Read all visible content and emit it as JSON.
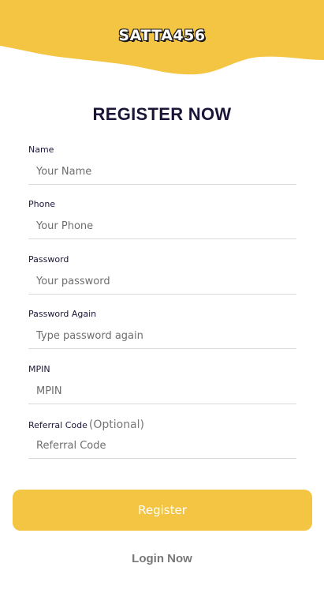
{
  "brand": {
    "logo_text": "SATTA456",
    "accent_color": "#f4c443"
  },
  "page": {
    "title": "REGISTER NOW"
  },
  "form": {
    "fields": [
      {
        "label": "Name",
        "placeholder": "Your Name",
        "value": ""
      },
      {
        "label": "Phone",
        "placeholder": "Your Phone",
        "value": ""
      },
      {
        "label": "Password",
        "placeholder": "Your password",
        "value": ""
      },
      {
        "label": "Password Again",
        "placeholder": "Type password again",
        "value": ""
      },
      {
        "label": "MPIN",
        "placeholder": "MPIN",
        "value": ""
      },
      {
        "label": "Referral Code",
        "label_suffix": "(Optional)",
        "placeholder": "Referral Code",
        "value": ""
      }
    ]
  },
  "actions": {
    "register_label": "Register",
    "login_label": "Login Now"
  }
}
